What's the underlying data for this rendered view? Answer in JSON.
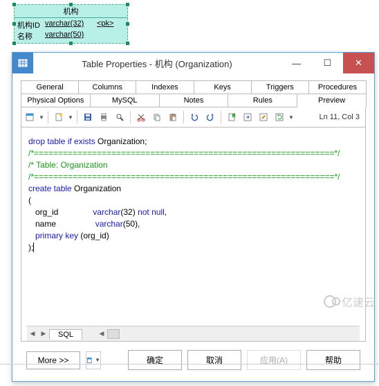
{
  "erd": {
    "title": "机构",
    "rows": [
      {
        "name": "机构ID",
        "type": "varchar(32)",
        "key": "<pk>"
      },
      {
        "name": "名称",
        "type": "varchar(50)",
        "key": ""
      }
    ]
  },
  "window": {
    "title": "Table Properties - 机构 (Organization)"
  },
  "tabs_row1": [
    "General",
    "Columns",
    "Indexes",
    "Keys",
    "Triggers",
    "Procedures"
  ],
  "tabs_row2": [
    "Physical Options",
    "MySQL",
    "Notes",
    "Rules",
    "Preview"
  ],
  "active_tab": "Preview",
  "cursor_pos": "Ln 11, Col 3",
  "editor_tab": "SQL",
  "buttons": {
    "more": "More >>",
    "ok": "确定",
    "cancel": "取消",
    "apply": "应用(A)",
    "help": "帮助"
  },
  "sql": {
    "l1a": "drop table if exists",
    "l1b": " Organization;",
    "l2": "/*==============================================================*/",
    "l3": "/* Table: Organization",
    "l4": "/*==============================================================*/",
    "l5a": "create table",
    "l5b": " Organization",
    "l6": "(",
    "l7a": "   org_id               ",
    "l7b": "varchar",
    "l7c": "(32) ",
    "l7d": "not null",
    "l7e": ",",
    "l8a": "   name                 ",
    "l8b": "varchar",
    "l8c": "(50),",
    "l9a": "   ",
    "l9b": "primary key",
    "l9c": " (org_id)",
    "l10": ");"
  },
  "watermark": "亿速云"
}
